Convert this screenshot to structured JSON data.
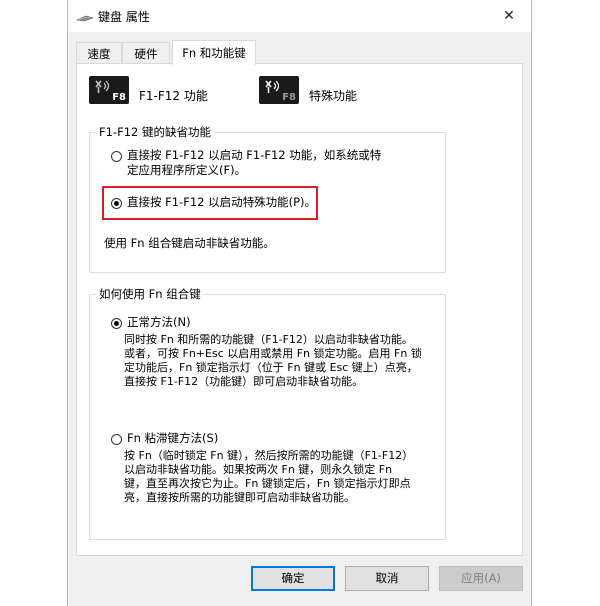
{
  "window": {
    "title": "键盘 属性",
    "close_symbol": "✕"
  },
  "tabs": [
    {
      "label": "速度"
    },
    {
      "label": "硬件"
    },
    {
      "label": "Fn 和功能键",
      "active": true
    }
  ],
  "fn_icons": {
    "key_label": "F8",
    "left_label": "F1-F12 功能",
    "right_label": "特殊功能"
  },
  "group1": {
    "title": "F1-F12 键的缺省功能",
    "option1": {
      "line1": "直接按 F1-F12 以启动 F1-F12 功能，如系统或特",
      "line2": "定应用程序所定义(F)。",
      "checked": false
    },
    "option2": {
      "label": "直接按 F1-F12 以启动特殊功能(P)。",
      "checked": true
    },
    "note": "使用 Fn 组合键启动非缺省功能。"
  },
  "group2": {
    "title": "如何使用 Fn 组合键",
    "normal": {
      "label": "正常方法(N)",
      "checked": true,
      "desc": [
        "同时按 Fn 和所需的功能键（F1-F12）以启动非缺省功能。",
        "或者，可按 Fn+Esc 以启用或禁用 Fn 锁定功能。启用 Fn 锁",
        "定功能后，Fn 锁定指示灯（位于 Fn 键或 Esc 键上）点亮，",
        "直接按 F1-F12（功能键）即可启动非缺省功能。"
      ]
    },
    "sticky": {
      "label": "Fn 粘滞键方法(S)",
      "checked": false,
      "desc": [
        "按 Fn（临时锁定 Fn 键），然后按所需的功能键（F1-F12）",
        "以启动非缺省功能。如果按两次 Fn 键，则永久锁定 Fn",
        "键，直至再次按它为止。Fn 键锁定后，Fn 锁定指示灯即点",
        "亮，直接按所需的功能键即可启动非缺省功能。"
      ]
    }
  },
  "buttons": {
    "ok": "确定",
    "cancel": "取消",
    "apply": "应用(A)"
  },
  "colors": {
    "highlight": "#d9202a",
    "accent": "#0078d7"
  }
}
